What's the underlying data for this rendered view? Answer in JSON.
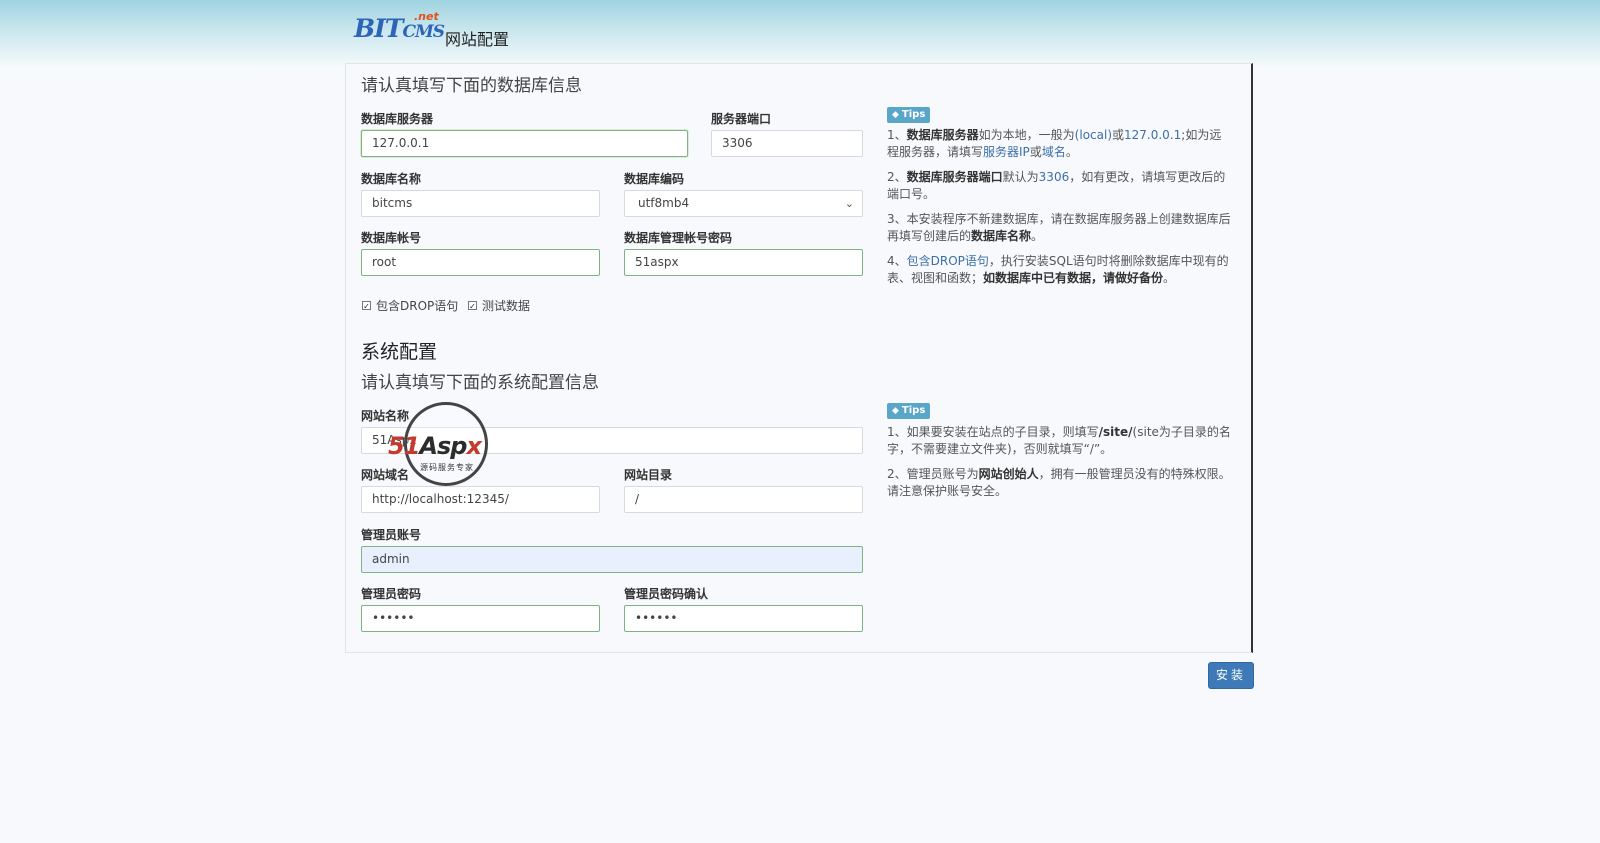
{
  "header": {
    "logo_main": "BIT",
    "logo_cms": "CMS",
    "logo_net": ".net",
    "page_title": "网站配置"
  },
  "database": {
    "subtitle": "请认真填写下面的数据库信息",
    "server_label": "数据库服务器",
    "server_value": "127.0.0.1",
    "port_label": "服务器端口",
    "port_value": "3306",
    "dbname_label": "数据库名称",
    "dbname_value": "bitcms",
    "encoding_label": "数据库编码",
    "encoding_value": "utf8mb4",
    "account_label": "数据库帐号",
    "account_value": "root",
    "password_label": "数据库管理帐号密码",
    "password_value": "51aspx",
    "drop_label": "包含DROP语句",
    "drop_checked": true,
    "testdata_label": "测试数据",
    "testdata_checked": true
  },
  "db_tips": {
    "badge": "Tips",
    "tip1": {
      "n": "1、",
      "b": "数据库服务器",
      "t1": "如为本地，一般为",
      "k1": "(local)",
      "t2": "或",
      "k2": "127.0.0.1",
      "t3": ";如为远程服务器，请填写",
      "k3": "服务器IP",
      "t4": "或",
      "k4": "域名",
      "t5": "。"
    },
    "tip2": {
      "n": "2、",
      "b": "数据库服务器端口",
      "t1": "默认为",
      "k1": "3306",
      "t2": "，如有更改，请填写更改后的端口号。"
    },
    "tip3": {
      "t1": "3、本安装程序不新建数据库，请在数据库服务器上创建数据库后再填写创建后的",
      "b": "数据库名称",
      "t2": "。"
    },
    "tip4": {
      "n": "4、",
      "k1": "包含DROP语句",
      "t1": "，执行安装SQL语句时将删除数据库中现有的表、视图和函数；",
      "b": "如数据库中已有数据，请做好备份",
      "t2": "。"
    }
  },
  "system": {
    "title": "系统配置",
    "subtitle": "请认真填写下面的系统配置信息",
    "sitename_label": "网站名称",
    "sitename_value": "51Aspx",
    "domain_label": "网站域名",
    "domain_value": "http://localhost:12345/",
    "dir_label": "网站目录",
    "dir_value": "/",
    "admin_label": "管理员账号",
    "admin_value": "admin",
    "adminpw_label": "管理员密码",
    "adminpw_value": "••••••",
    "adminpw2_label": "管理员密码确认",
    "adminpw2_value": "••••••"
  },
  "sys_tips": {
    "badge": "Tips",
    "tip1": {
      "t1": "1、如果要安装在站点的子目录，则填写",
      "b1": "/site/",
      "t2": "(site为子目录的名字，不需要建立文件夹)，否则就填写“/”。"
    },
    "tip2": {
      "t1": "2、管理员账号为",
      "b": "网站创始人",
      "t2": "，拥有一般管理员没有的特殊权限。请注意保护账号安全。"
    }
  },
  "watermark": {
    "brand_51": "51",
    "brand_asp": "Asp",
    "brand_x": "x",
    "slogan": "源码服务专家"
  },
  "actions": {
    "install_label": "安装"
  }
}
